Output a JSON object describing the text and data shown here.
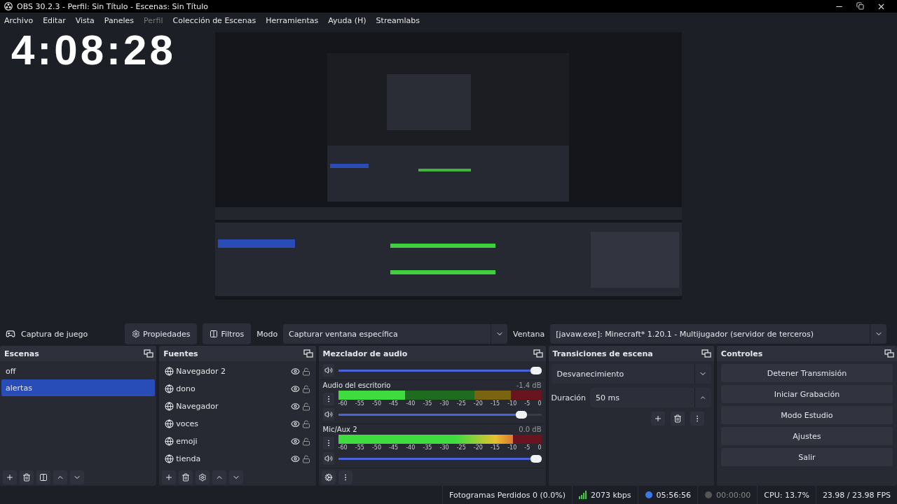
{
  "window": {
    "title": "OBS 30.2.3 - Perfil: Sin Título - Escenas: Sin Título"
  },
  "menu": [
    {
      "label": "Archivo",
      "disabled": false
    },
    {
      "label": "Editar",
      "disabled": false
    },
    {
      "label": "Vista",
      "disabled": false
    },
    {
      "label": "Paneles",
      "disabled": false
    },
    {
      "label": "Perfil",
      "disabled": true
    },
    {
      "label": "Colección de Escenas",
      "disabled": false
    },
    {
      "label": "Herramientas",
      "disabled": false
    },
    {
      "label": "Ayuda (H)",
      "disabled": false
    },
    {
      "label": "Streamlabs",
      "disabled": false
    }
  ],
  "clock_overlay": {
    "time": "4:08:28"
  },
  "source_toolbar": {
    "source": "Captura de juego",
    "buttons": [
      {
        "kind": "properties",
        "label": "Propiedades"
      },
      {
        "kind": "filters",
        "label": "Filtros"
      }
    ],
    "mode_label": "Modo",
    "mode_value": "Capturar ventana específica",
    "window_label": "Ventana",
    "window_value": "[javaw.exe]: Minecraft* 1.20.1 - Multijugador (servidor de terceros)"
  },
  "scenes": {
    "title": "Escenas",
    "items": [
      {
        "label": "off",
        "selected": false
      },
      {
        "label": "alertas",
        "selected": true
      }
    ]
  },
  "sources": {
    "title": "Fuentes",
    "items": [
      {
        "label": "Navegador 2",
        "visible": true,
        "locked": false
      },
      {
        "label": "dono",
        "visible": true,
        "locked": false
      },
      {
        "label": "Navegador",
        "visible": true,
        "locked": false
      },
      {
        "label": "voces",
        "visible": true,
        "locked": false
      },
      {
        "label": "emoji",
        "visible": true,
        "locked": false
      },
      {
        "label": "tienda",
        "visible": true,
        "locked": false
      }
    ]
  },
  "mixer": {
    "title": "Mezclador de audio",
    "channels": [
      {
        "kind": "partial",
        "muted": false,
        "volume": {
          "level": 1
        }
      },
      {
        "kind": "full",
        "name": "Audio del escritorio",
        "reading": "-1.4 dB",
        "muted": false,
        "meter": {
          "level": 0.33
        },
        "volume": {
          "level": 0.93
        },
        "scale": [
          "-60",
          "-55",
          "-50",
          "-45",
          "-40",
          "-35",
          "-30",
          "-25",
          "-20",
          "-15",
          "-10",
          "-5",
          "0"
        ]
      },
      {
        "kind": "full",
        "name": "Mic/Aux 2",
        "reading": "0.0 dB",
        "muted": false,
        "meter": {
          "level": 0.86
        },
        "volume": {
          "level": 1
        },
        "scale": [
          "-60",
          "-55",
          "-50",
          "-45",
          "-40",
          "-35",
          "-30",
          "-25",
          "-20",
          "-15",
          "-10",
          "-5",
          "0"
        ]
      }
    ]
  },
  "transitions": {
    "title": "Transiciones de escena",
    "transition": "Desvanecimiento",
    "duration_label": "Duración",
    "duration": "50 ms"
  },
  "controls": {
    "title": "Controles",
    "buttons": [
      "Detener Transmisión",
      "Iniciar Grabación",
      "Modo Estudio",
      "Ajustes",
      "Salir"
    ]
  },
  "status_bar": {
    "dropped_frames": "Fotogramas Perdidos 0 (0.0%)",
    "bitrate": "2073 kbps",
    "stream_time": "05:56:56",
    "streaming": true,
    "record_time": "00:00:00",
    "recording": false,
    "cpu": "CPU: 13.7%",
    "fps": "23.98 / 23.98 FPS"
  }
}
